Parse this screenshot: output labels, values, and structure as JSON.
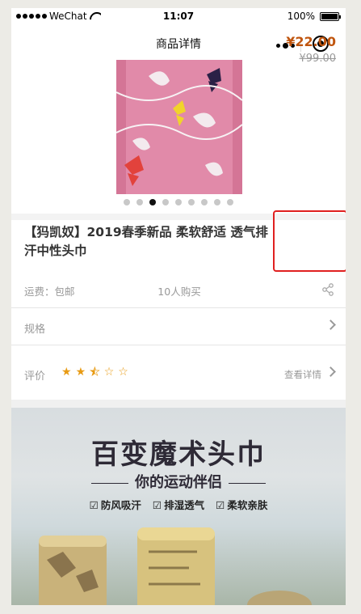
{
  "statusbar": {
    "carrier": "WeChat",
    "time": "11:07",
    "battery": "100%"
  },
  "navbar": {
    "title": "商品详情"
  },
  "product": {
    "title": "【犸凯奴】2019春季新品 柔软舒适 透气排汗中性头巾",
    "price": "¥22.00",
    "old_price": "¥99.00",
    "image_count": 9,
    "active_image": 2
  },
  "meta": {
    "shipping": "运费：包邮",
    "sold": "10人购买"
  },
  "spec": {
    "label": "规格"
  },
  "review": {
    "label": "评价",
    "rating": 2.5,
    "max": 5,
    "link": "查看详情"
  },
  "banner": {
    "headline": "百变魔术头巾",
    "subline": "你的运动伴侣",
    "features": [
      "防风吸汗",
      "排湿透气",
      "柔软亲肤"
    ]
  },
  "colors": {
    "price": "#c0550e",
    "highlight_border": "#e02020",
    "star": "#e89b14"
  }
}
